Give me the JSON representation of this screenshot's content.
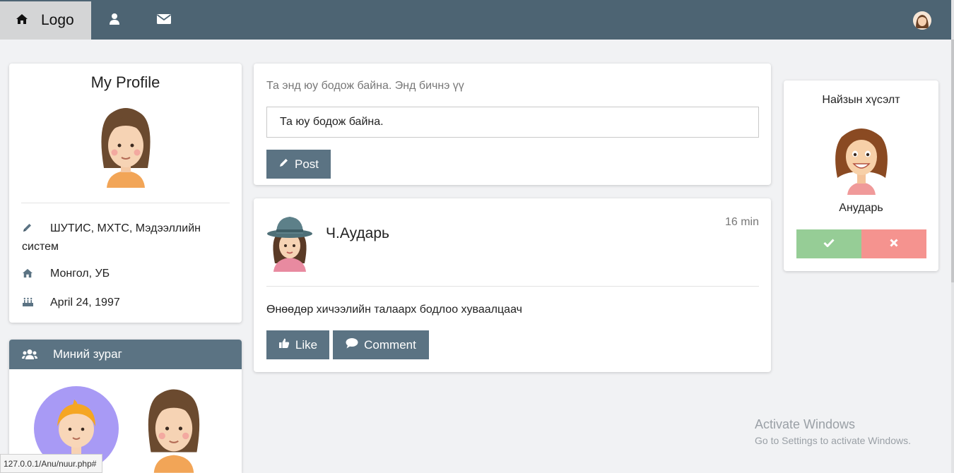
{
  "nav": {
    "logo_label": "Logo",
    "home_icon": "home-icon",
    "profile_icon": "user-icon",
    "messages_icon": "envelope-icon",
    "avatar_icon": "avatar"
  },
  "profile": {
    "title": "My Profile",
    "education": "ШУТИС, МХТС, Мэдээллийн систем",
    "location": "Монгол, УБ",
    "birthday": "April 24, 1997"
  },
  "photos": {
    "title": "Миний зураг"
  },
  "composer": {
    "prompt": "Та энд юу бодож байна. Энд бичнэ үү",
    "input_value": "Та юу бодож байна.",
    "post_label": "Post"
  },
  "post": {
    "author": "Ч.Аударь",
    "time": "16 min",
    "body": "Өнөөдөр хичээлийн талаарх бодлоо хуваалцаач",
    "like_label": "Like",
    "comment_label": "Comment"
  },
  "friend_request": {
    "title": "Найзын хүсэлт",
    "name": "Анударь"
  },
  "system": {
    "activate_title": "Activate Windows",
    "activate_subtitle": "Go to Settings to activate Windows.",
    "status_url": "127.0.0.1/Anu/nuur.php#"
  },
  "colors": {
    "navbar": "#4d6473",
    "button": "#5b7383",
    "accept": "#96cd96",
    "decline": "#f5938f"
  }
}
